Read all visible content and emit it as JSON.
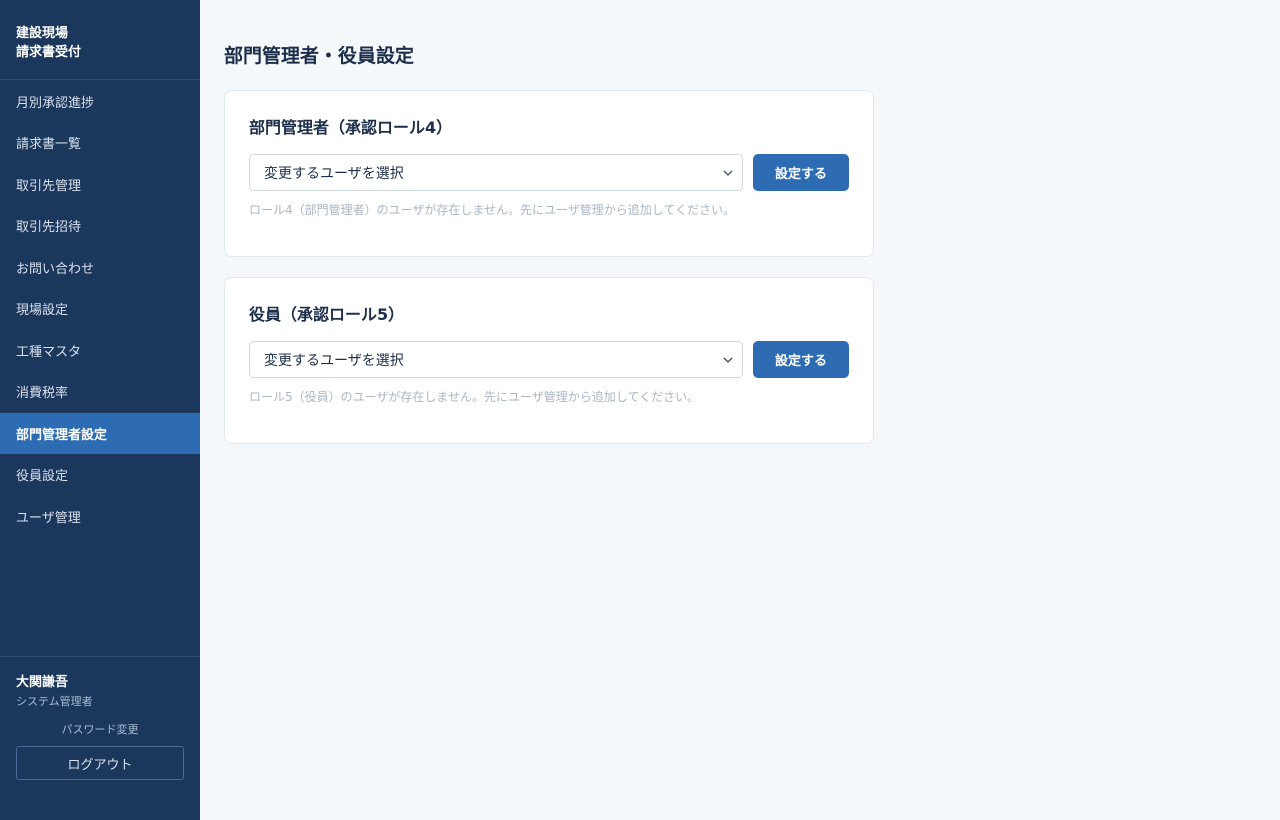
{
  "sidebar": {
    "brand_line1": "建設現場",
    "brand_line2": "請求書受付",
    "items": [
      {
        "label": "月別承認進捗"
      },
      {
        "label": "請求書一覧"
      },
      {
        "label": "取引先管理"
      },
      {
        "label": "取引先招待"
      },
      {
        "label": "お問い合わせ"
      },
      {
        "label": "現場設定"
      },
      {
        "label": "工種マスタ"
      },
      {
        "label": "消費税率"
      },
      {
        "label": "部門管理者設定"
      },
      {
        "label": "役員設定"
      },
      {
        "label": "ユーザ管理"
      }
    ],
    "active_index": 8,
    "user_name": "大関謙吾",
    "user_role": "システム管理者",
    "password_link": "パスワード変更",
    "logout_label": "ログアウト"
  },
  "main": {
    "title": "部門管理者・役員設定",
    "cards": [
      {
        "title": "部門管理者（承認ロール4）",
        "select_value": "変更するユーザを選択",
        "button_label": "設定する",
        "hint": "ロール4（部門管理者）のユーザが存在しません。先にユーザ管理から追加してください。"
      },
      {
        "title": "役員（承認ロール5）",
        "select_value": "変更するユーザを選択",
        "button_label": "設定する",
        "hint": "ロール5（役員）のユーザが存在しません。先にユーザ管理から追加してください。"
      }
    ]
  },
  "colors": {
    "sidebar_bg": "#1c375c",
    "active_bg": "#2d6cb2",
    "button_bg": "#2d6cb2",
    "page_bg": "#f5f8fb"
  },
  "icons": {
    "select_chevron": "chevron-down-icon"
  }
}
